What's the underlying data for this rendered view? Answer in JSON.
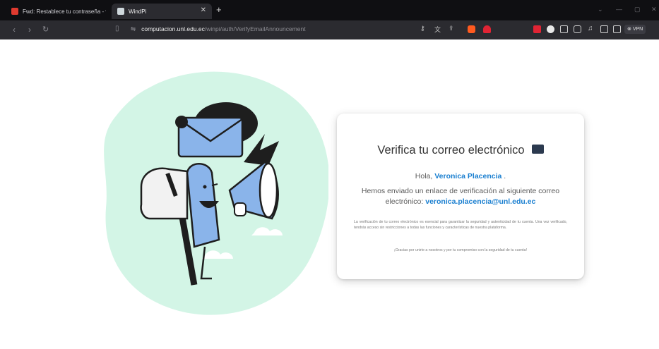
{
  "browser": {
    "tabs": [
      {
        "label": "Fwd: Restablece tu contraseña - vero",
        "icon": "gmail-icon",
        "active": false
      },
      {
        "label": "WindPi",
        "icon": "windpi-icon",
        "active": true
      }
    ],
    "new_tab_label": "+",
    "url_scheme_icon": "site-info-icon",
    "url_host": "computacion.unl.edu.ec",
    "url_path": "/winpi/auth/VerifyEmailAnnouncement",
    "vpn_label": "VPN",
    "accent_brave": "#ff5a1f",
    "accent_red": "#e02434"
  },
  "card": {
    "title": "Verifica tu correo electrónico",
    "title_icon": "envelope-icon",
    "greeting_prefix": "Hola,",
    "user_name": "Veronica Placencia",
    "greeting_suffix": ".",
    "message_prefix": "Hemos enviado un enlace de verificación al siguiente correo electrónico:",
    "email": "veronica.placencia@unl.edu.ec",
    "info_text": "La verificación de tu correo electrónico es esencial para garantizar la seguridad y autenticidad de tu cuenta. Una vez verificado, tendrás acceso sin restricciones a todas las funciones y características de nuestra plataforma.",
    "thanks_text": "¡Gracias por unirte a nosotros y por tu compromiso con la seguridad de tu cuenta!",
    "accent": "#1a7fd0"
  },
  "illustration": {
    "description_icon": "mailbox-megaphone-illustration",
    "blob_color": "#d3f5e6"
  }
}
